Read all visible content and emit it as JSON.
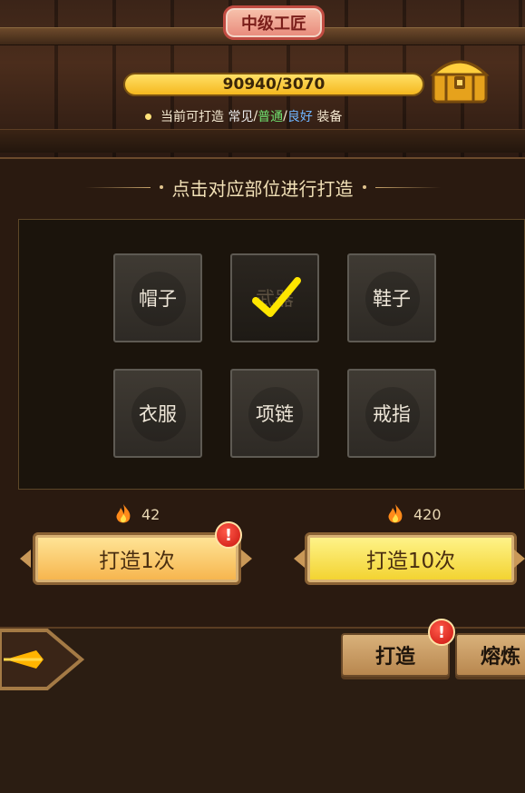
{
  "header": {
    "title": "中级工匠",
    "progress_text": "90940/3070",
    "progress_fraction": 1.0
  },
  "craft_info": {
    "prefix": "当前可打造",
    "quality_common": "常见",
    "separator": "/",
    "quality_normal": "普通",
    "quality_good": "良好",
    "suffix": "装备"
  },
  "instruction": "点击对应部位进行打造",
  "slots": [
    {
      "label": "帽子",
      "selected": false
    },
    {
      "label": "武器",
      "selected": true
    },
    {
      "label": "鞋子",
      "selected": false
    },
    {
      "label": "衣服",
      "selected": false
    },
    {
      "label": "项链",
      "selected": false
    },
    {
      "label": "戒指",
      "selected": false
    }
  ],
  "forge": {
    "once": {
      "cost": "42",
      "label": "打造1次",
      "badge": "!"
    },
    "ten": {
      "cost": "420",
      "label": "打造10次"
    }
  },
  "tabs": {
    "forge": {
      "label": "打造",
      "badge": "!"
    },
    "smelt": {
      "label": "熔炼"
    }
  },
  "colors": {
    "progress_fill": "#f5b81f",
    "quality_normal": "#6fe06f",
    "quality_good": "#6fb5ff",
    "badge_red": "#c9140e",
    "checkmark": "#ffe600"
  }
}
